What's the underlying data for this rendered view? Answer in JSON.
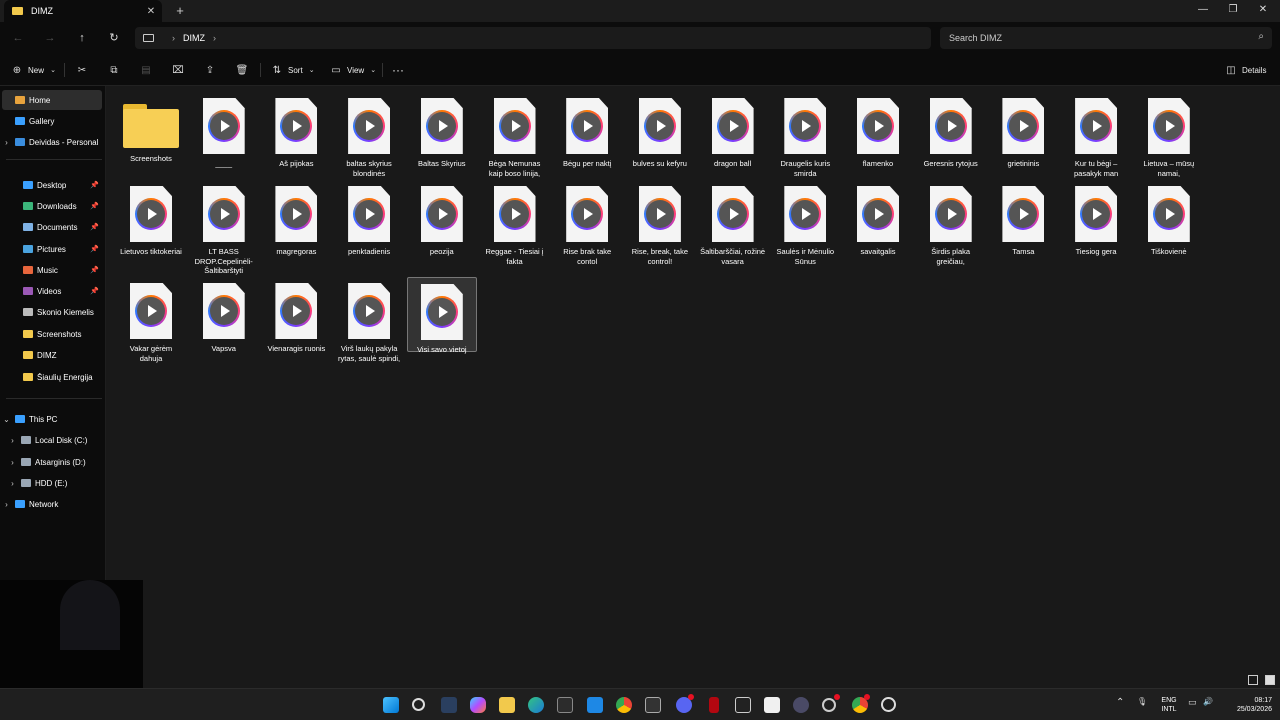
{
  "window": {
    "tab_title": "DIMZ",
    "tab_close": "✕",
    "new_tab": "+",
    "minimize": "—",
    "maximize": "❐",
    "close": "✕"
  },
  "address": {
    "back": "←",
    "forward": "→",
    "up": "↑",
    "refresh": "↻",
    "breadcrumb_folder": "DIMZ",
    "chevron": "›",
    "search_placeholder": "Search DIMZ",
    "search_icon": "⌕"
  },
  "commands": {
    "new_label": "New",
    "sort_label": "Sort",
    "view_label": "View",
    "more_label": "···",
    "details_label": "Details",
    "icons": {
      "new": "⊕",
      "cut": "✂",
      "copy": "⧉",
      "paste": "▤",
      "rename": "⌧",
      "share": "⇪",
      "delete": "🗑",
      "sort": "⇅",
      "view": "▭",
      "dropdown": "⌄",
      "details": "◫"
    }
  },
  "sidebar": {
    "items": [
      {
        "label": "Home",
        "chevron": "",
        "icon_color": "#e8a33d",
        "pin": "",
        "active": true
      },
      {
        "label": "Gallery",
        "chevron": "",
        "icon_color": "#3aa0ff",
        "pin": ""
      },
      {
        "label": "Deividas - Personal",
        "chevron": "›",
        "icon_color": "#3a8dde",
        "pin": ""
      },
      {
        "label": "Desktop",
        "chevron": "",
        "icon_color": "#3aa0ff",
        "pin": "📌"
      },
      {
        "label": "Downloads",
        "chevron": "",
        "icon_color": "#3bb57a",
        "pin": "📌"
      },
      {
        "label": "Documents",
        "chevron": "",
        "icon_color": "#7fb2e5",
        "pin": "📌"
      },
      {
        "label": "Pictures",
        "chevron": "",
        "icon_color": "#4aa3df",
        "pin": "📌"
      },
      {
        "label": "Music",
        "chevron": "",
        "icon_color": "#e8663d",
        "pin": "📌"
      },
      {
        "label": "Videos",
        "chevron": "",
        "icon_color": "#9b59b6",
        "pin": "📌"
      },
      {
        "label": "Skonio Kiemelis",
        "chevron": "",
        "icon_color": "#bbbbbb",
        "pin": ""
      },
      {
        "label": "Screenshots",
        "chevron": "",
        "icon_color": "#f2c94c",
        "pin": ""
      },
      {
        "label": "DIMZ",
        "chevron": "",
        "icon_color": "#f2c94c",
        "pin": ""
      },
      {
        "label": "Šiaulių Energija",
        "chevron": "",
        "icon_color": "#f2c94c",
        "pin": ""
      },
      {
        "label": "This PC",
        "chevron": "⌄",
        "icon_color": "#3aa0ff",
        "pin": ""
      },
      {
        "label": "Local Disk (C:)",
        "chevron": "›",
        "icon_color": "#9aa7b5",
        "pin": ""
      },
      {
        "label": "Atsarginis (D:)",
        "chevron": "›",
        "icon_color": "#9aa7b5",
        "pin": ""
      },
      {
        "label": "HDD (E:)",
        "chevron": "›",
        "icon_color": "#9aa7b5",
        "pin": ""
      },
      {
        "label": "Network",
        "chevron": "›",
        "icon_color": "#3aa0ff",
        "pin": ""
      }
    ]
  },
  "files": [
    {
      "name": "Screenshots",
      "type": "folder"
    },
    {
      "name": "____",
      "type": "video"
    },
    {
      "name": "Aš pijokas",
      "type": "video"
    },
    {
      "name": "baltas skyrius blondinės",
      "type": "video"
    },
    {
      "name": "Baltas Skyrius",
      "type": "video"
    },
    {
      "name": "Bėga Nemunas kaip boso linija,",
      "type": "video"
    },
    {
      "name": "Bėgu per naktį",
      "type": "video"
    },
    {
      "name": "bulves su kefyru",
      "type": "video"
    },
    {
      "name": "dragon ball",
      "type": "video"
    },
    {
      "name": "Draugelis kuris smirda",
      "type": "video"
    },
    {
      "name": "flamenko",
      "type": "video"
    },
    {
      "name": "Geresnis rytojus",
      "type": "video"
    },
    {
      "name": "grietininis",
      "type": "video"
    },
    {
      "name": "Kur tu bėgi – pasakyk man",
      "type": "video"
    },
    {
      "name": "Lietuva – mūsų namai,",
      "type": "video"
    },
    {
      "name": "Lietuvos tiktokeriai",
      "type": "video"
    },
    {
      "name": "LT BASS DROP.Cepelinėli-Šaltibarštyti",
      "type": "video"
    },
    {
      "name": "magregoras",
      "type": "video"
    },
    {
      "name": "penktadienis",
      "type": "video"
    },
    {
      "name": "peozija",
      "type": "video"
    },
    {
      "name": "Reggae - Tiesiai į fakta",
      "type": "video"
    },
    {
      "name": "Rise brak take contol",
      "type": "video"
    },
    {
      "name": "Rise, break, take control!",
      "type": "video"
    },
    {
      "name": "Šaltibarščiai, rožinė vasara",
      "type": "video"
    },
    {
      "name": "Saulės ir Mėnulio Sūnus",
      "type": "video"
    },
    {
      "name": "savaitgalis",
      "type": "video"
    },
    {
      "name": "Širdis plaka greičiau,",
      "type": "video"
    },
    {
      "name": "Tamsa",
      "type": "video"
    },
    {
      "name": "Tiesiog gera",
      "type": "video"
    },
    {
      "name": "Tiškovienė",
      "type": "video"
    },
    {
      "name": "Vakar gėrėm dahuja",
      "type": "video"
    },
    {
      "name": "Vapsva",
      "type": "video"
    },
    {
      "name": "Vienaragis ruonis",
      "type": "video"
    },
    {
      "name": "Virš laukų pakyla rytas, saulė spindi,",
      "type": "video"
    },
    {
      "name": "Visi savo vietoj",
      "type": "video",
      "selected": true
    }
  ],
  "taskbar": {
    "lang_line1": "ENG",
    "lang_line2": "INTL",
    "time": "08:17",
    "date": "25/03/2026",
    "tray_up": "⌃",
    "mic": "🎙",
    "monitor": "▭",
    "volume": "🔊"
  }
}
